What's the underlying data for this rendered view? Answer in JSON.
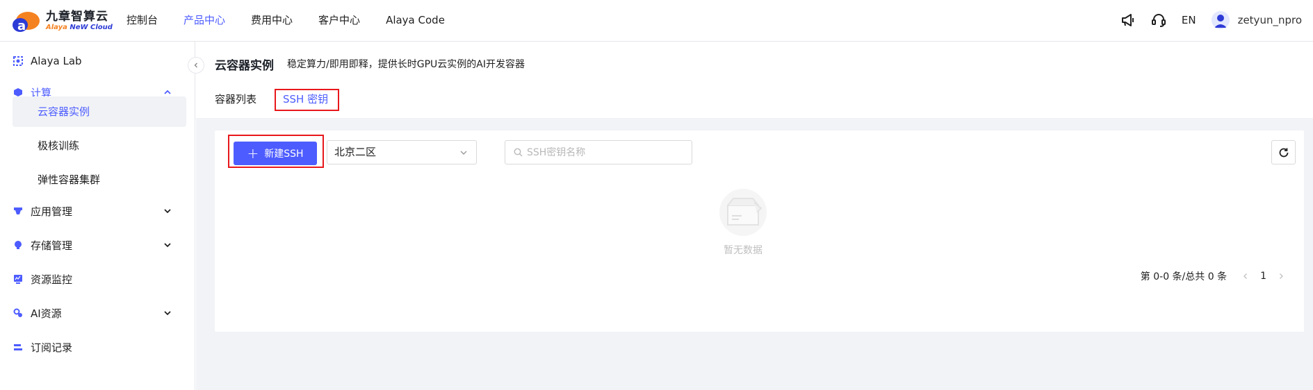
{
  "brand": {
    "name_cn": "九章智算云",
    "name_en_a": "Alaya ",
    "name_en_b": "NeW Cloud"
  },
  "nav": {
    "items": [
      "控制台",
      "产品中心",
      "费用中心",
      "客户中心",
      "Alaya Code"
    ],
    "active": "产品中心"
  },
  "topbar": {
    "lang": "EN",
    "username": "zetyun_npro",
    "icons": [
      "announcement-icon",
      "support-headset-icon"
    ]
  },
  "sidebar": {
    "items": [
      {
        "label": "Alaya Lab",
        "icon": "lab-icon"
      },
      {
        "label": "计算",
        "icon": "cube-icon",
        "expanded": true
      },
      {
        "label": "云容器实例",
        "sub": true,
        "active": true
      },
      {
        "label": "极核训练",
        "sub": true
      },
      {
        "label": "弹性容器集群",
        "sub": true
      },
      {
        "label": "应用管理",
        "icon": "app-icon",
        "expandable": true
      },
      {
        "label": "存储管理",
        "icon": "storage-icon",
        "expandable": true
      },
      {
        "label": "资源监控",
        "icon": "monitor-icon"
      },
      {
        "label": "AI资源",
        "icon": "ai-resource-icon",
        "expandable": true
      },
      {
        "label": "订阅记录",
        "icon": "subscription-icon"
      }
    ]
  },
  "page": {
    "title": "云容器实例",
    "description": "稳定算力/即用即释，提供长时GPU云实例的AI开发容器",
    "tabs": [
      "容器列表",
      "SSH 密钥"
    ],
    "active_tab": "SSH 密钥"
  },
  "toolbar": {
    "new_button": "新建SSH",
    "region_select": "北京二区",
    "search_placeholder": "SSH密钥名称"
  },
  "empty": {
    "text": "暂无数据"
  },
  "pagination": {
    "summary": "第 0-0 条/总共 0 条",
    "current_page": "1"
  },
  "colors": {
    "accent": "#4d5cff",
    "highlight": "#e8171b",
    "brand_orange": "#f58220"
  }
}
